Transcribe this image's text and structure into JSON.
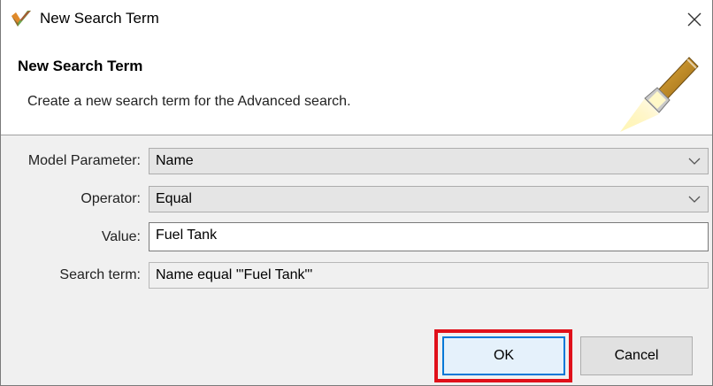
{
  "window": {
    "title": "New Search Term",
    "icon": "app-check-icon"
  },
  "banner": {
    "title": "New Search Term",
    "description": "Create a new search term for the Advanced search.",
    "icon": "flashlight-icon"
  },
  "form": {
    "model_parameter": {
      "label": "Model Parameter:",
      "value": "Name"
    },
    "operator": {
      "label": "Operator:",
      "value": "Equal"
    },
    "value": {
      "label": "Value:",
      "value": "Fuel Tank"
    },
    "search_term": {
      "label": "Search term:",
      "value": "Name equal '\"Fuel Tank\"'"
    }
  },
  "buttons": {
    "ok": "OK",
    "cancel": "Cancel"
  },
  "colors": {
    "highlight": "#e0101a",
    "default_button_border": "#0078d7"
  }
}
